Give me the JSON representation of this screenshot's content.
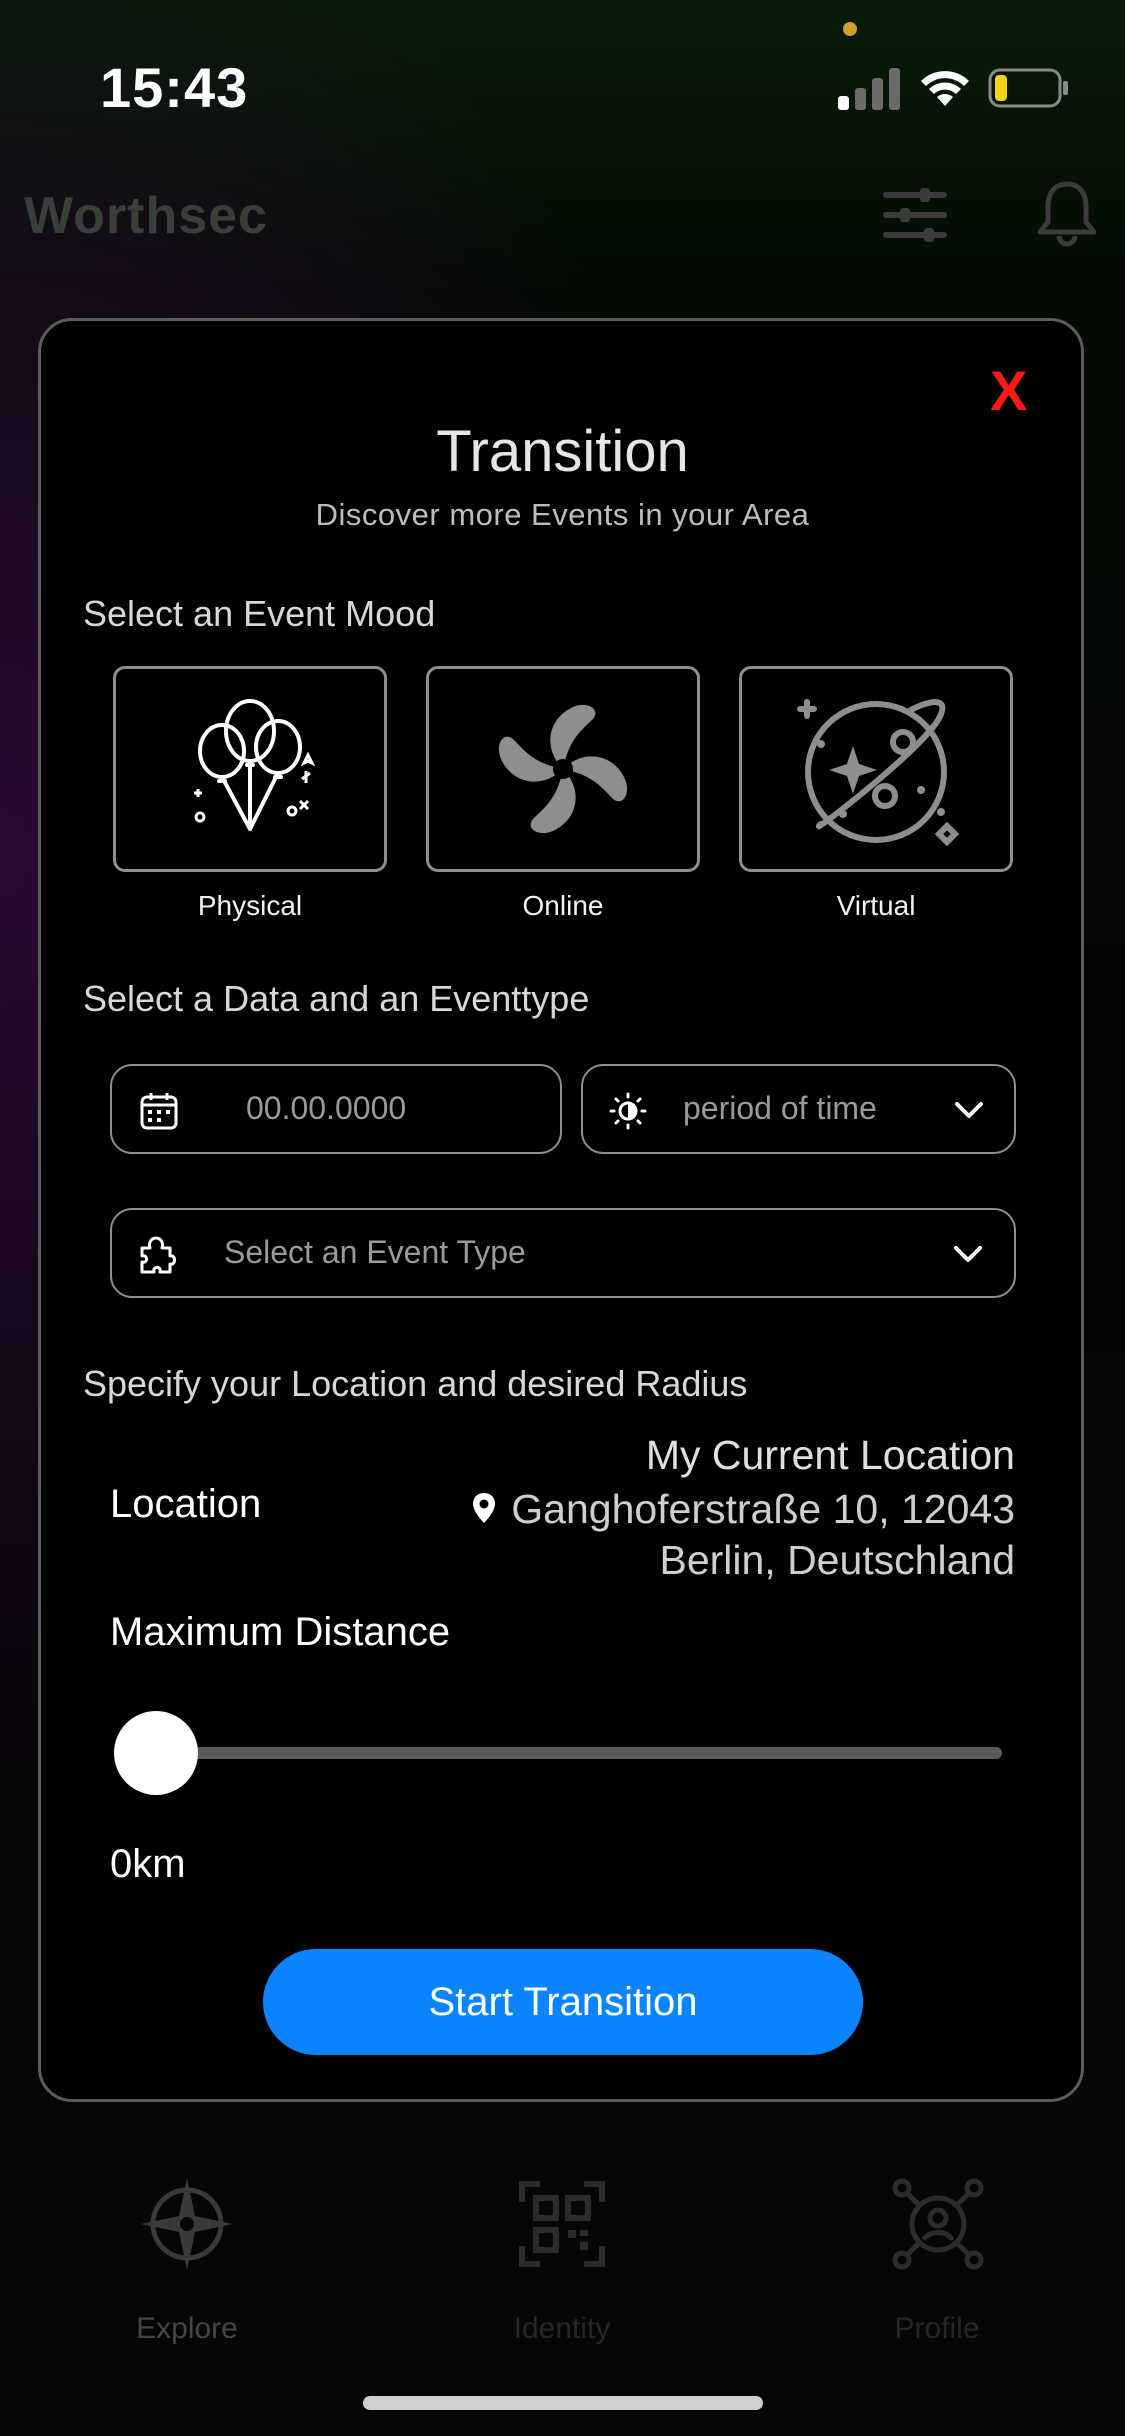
{
  "status_bar": {
    "time": "15:43",
    "battery_level": 0.2,
    "battery_color": "#f2d21b"
  },
  "app": {
    "title": "Worthsec",
    "header_icons": [
      "sliders-icon",
      "bell-icon"
    ]
  },
  "modal": {
    "close_label": "X",
    "title": "Transition",
    "subtitle": "Discover more Events in your Area",
    "mood_section_label": "Select an Event Mood",
    "moods": [
      {
        "label": "Physical",
        "icon": "balloons-icon"
      },
      {
        "label": "Online",
        "icon": "pinwheel-icon"
      },
      {
        "label": "Virtual",
        "icon": "planet-icon"
      }
    ],
    "date_section_label": "Select a Data and an Eventtype",
    "date_field": {
      "placeholder": "00.00.0000",
      "icon": "calendar-icon"
    },
    "period_select": {
      "value": "period of time",
      "icon": "brightness-icon"
    },
    "event_type_select": {
      "value": "Select an Event Type",
      "icon": "puzzle-icon"
    },
    "location_section_label": "Specify your Location and desired Radius",
    "location": {
      "label": "Location",
      "title": "My Current Location",
      "address_line1": "Ganghoferstraße 10, 12043",
      "address_line2": "Berlin, Deutschland",
      "icon": "location-pin-icon"
    },
    "distance": {
      "label": "Maximum Distance",
      "value_text": "0km",
      "slider_fraction": 0
    },
    "start_button_label": "Start Transition",
    "accent_color": "#0a84ff",
    "close_color": "#ff1a1a"
  },
  "bottom_nav": {
    "items": [
      {
        "label": "Explore",
        "icon": "compass-icon"
      },
      {
        "label": "Identity",
        "icon": "qr-code-icon"
      },
      {
        "label": "Profile",
        "icon": "profile-network-icon"
      }
    ]
  }
}
